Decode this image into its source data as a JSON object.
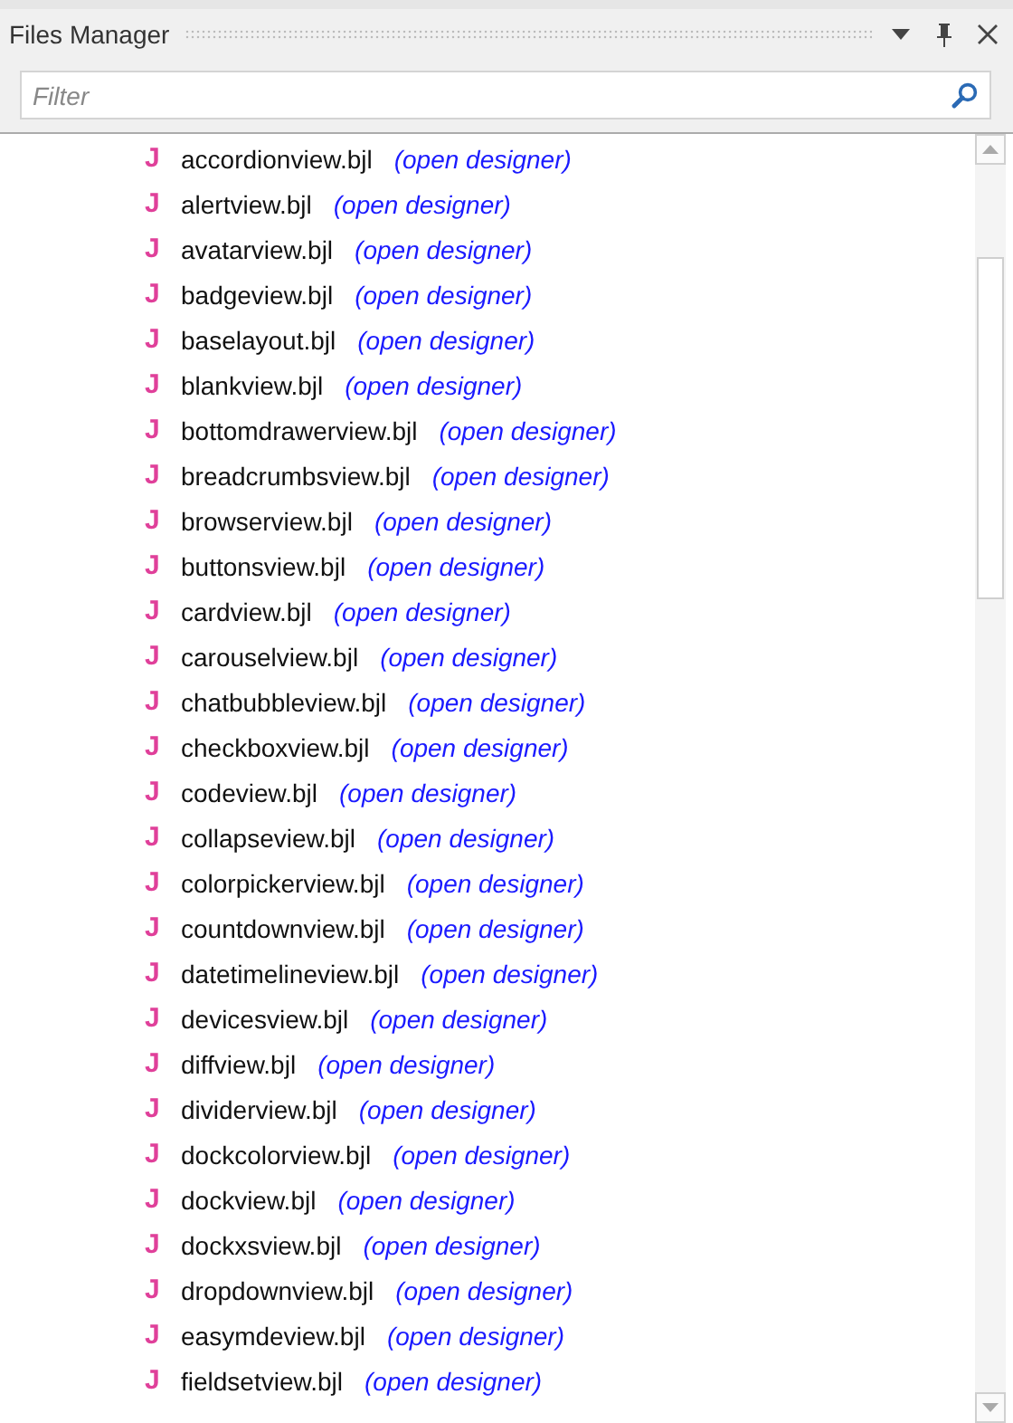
{
  "panel": {
    "title": "Files Manager"
  },
  "filter": {
    "placeholder": "Filter"
  },
  "files": [
    {
      "icon": "J",
      "name": "accordionview.bjl",
      "action": "(open designer)"
    },
    {
      "icon": "J",
      "name": "alertview.bjl",
      "action": "(open designer)"
    },
    {
      "icon": "J",
      "name": "avatarview.bjl",
      "action": "(open designer)"
    },
    {
      "icon": "J",
      "name": "badgeview.bjl",
      "action": "(open designer)"
    },
    {
      "icon": "J",
      "name": "baselayout.bjl",
      "action": "(open designer)"
    },
    {
      "icon": "J",
      "name": "blankview.bjl",
      "action": "(open designer)"
    },
    {
      "icon": "J",
      "name": "bottomdrawerview.bjl",
      "action": "(open designer)"
    },
    {
      "icon": "J",
      "name": "breadcrumbsview.bjl",
      "action": "(open designer)"
    },
    {
      "icon": "J",
      "name": "browserview.bjl",
      "action": "(open designer)"
    },
    {
      "icon": "J",
      "name": "buttonsview.bjl",
      "action": "(open designer)"
    },
    {
      "icon": "J",
      "name": "cardview.bjl",
      "action": "(open designer)"
    },
    {
      "icon": "J",
      "name": "carouselview.bjl",
      "action": "(open designer)"
    },
    {
      "icon": "J",
      "name": "chatbubbleview.bjl",
      "action": "(open designer)"
    },
    {
      "icon": "J",
      "name": "checkboxview.bjl",
      "action": "(open designer)"
    },
    {
      "icon": "J",
      "name": "codeview.bjl",
      "action": "(open designer)"
    },
    {
      "icon": "J",
      "name": "collapseview.bjl",
      "action": "(open designer)"
    },
    {
      "icon": "J",
      "name": "colorpickerview.bjl",
      "action": "(open designer)"
    },
    {
      "icon": "J",
      "name": "countdownview.bjl",
      "action": "(open designer)"
    },
    {
      "icon": "J",
      "name": "datetimelineview.bjl",
      "action": "(open designer)"
    },
    {
      "icon": "J",
      "name": "devicesview.bjl",
      "action": "(open designer)"
    },
    {
      "icon": "J",
      "name": "diffview.bjl",
      "action": "(open designer)"
    },
    {
      "icon": "J",
      "name": "dividerview.bjl",
      "action": "(open designer)"
    },
    {
      "icon": "J",
      "name": "dockcolorview.bjl",
      "action": "(open designer)"
    },
    {
      "icon": "J",
      "name": "dockview.bjl",
      "action": "(open designer)"
    },
    {
      "icon": "J",
      "name": "dockxsview.bjl",
      "action": "(open designer)"
    },
    {
      "icon": "J",
      "name": "dropdownview.bjl",
      "action": "(open designer)"
    },
    {
      "icon": "J",
      "name": "easymdeview.bjl",
      "action": "(open designer)"
    },
    {
      "icon": "J",
      "name": "fieldsetview.bjl",
      "action": "(open designer)"
    }
  ]
}
